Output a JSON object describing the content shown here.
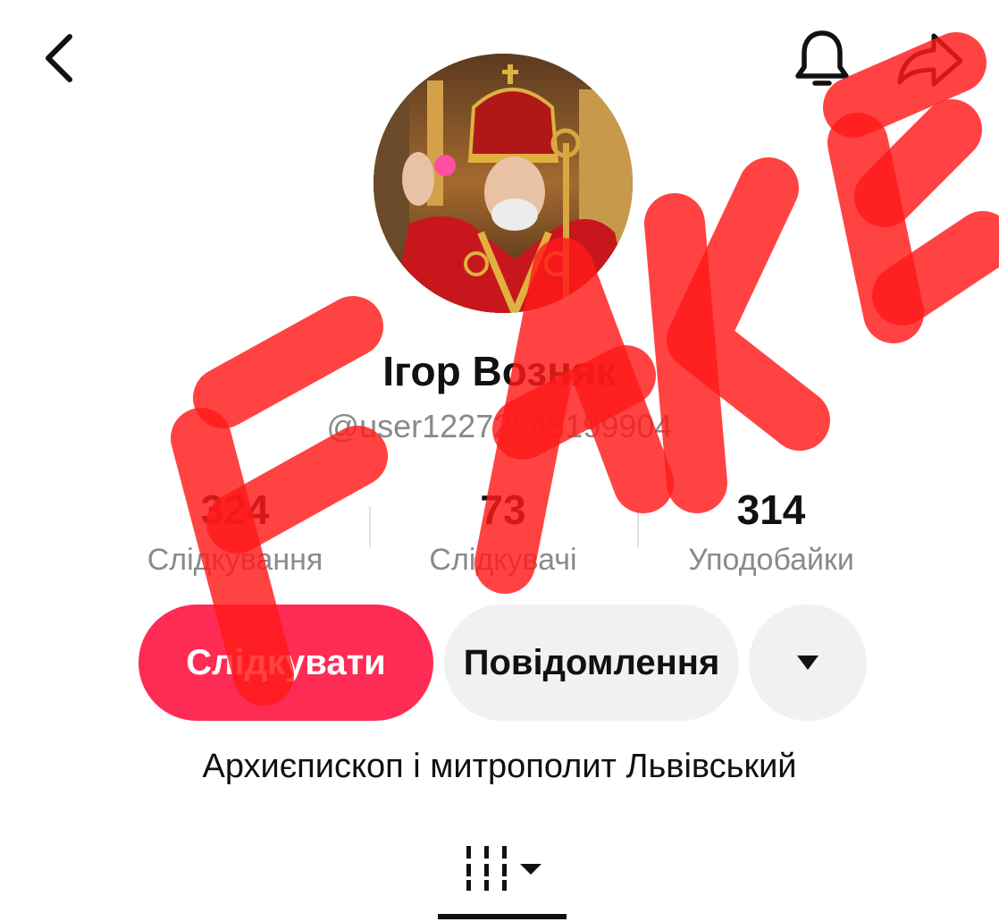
{
  "profile": {
    "display_name": "Ігор Возняк",
    "username": "@user12272948199904",
    "bio": "Архиєпископ і митрополит Львівський"
  },
  "stats": [
    {
      "value": "324",
      "label": "Слідкування"
    },
    {
      "value": "73",
      "label": "Слідкувачі"
    },
    {
      "value": "314",
      "label": "Уподобайки"
    }
  ],
  "actions": {
    "follow_label": "Слідкувати",
    "message_label": "Повідомлення"
  },
  "icons": {
    "back": "chevron-left-icon",
    "notifications": "bell-icon",
    "share": "share-arrow-icon",
    "more": "caret-down-icon",
    "videos_tab": "grid-icon"
  },
  "overlay": {
    "text": "FAKE",
    "color": "#ff1a1a"
  },
  "colors": {
    "accent": "#fe2c55",
    "secondary_button": "#f1f1f2",
    "muted_text": "#8a8a8a"
  }
}
